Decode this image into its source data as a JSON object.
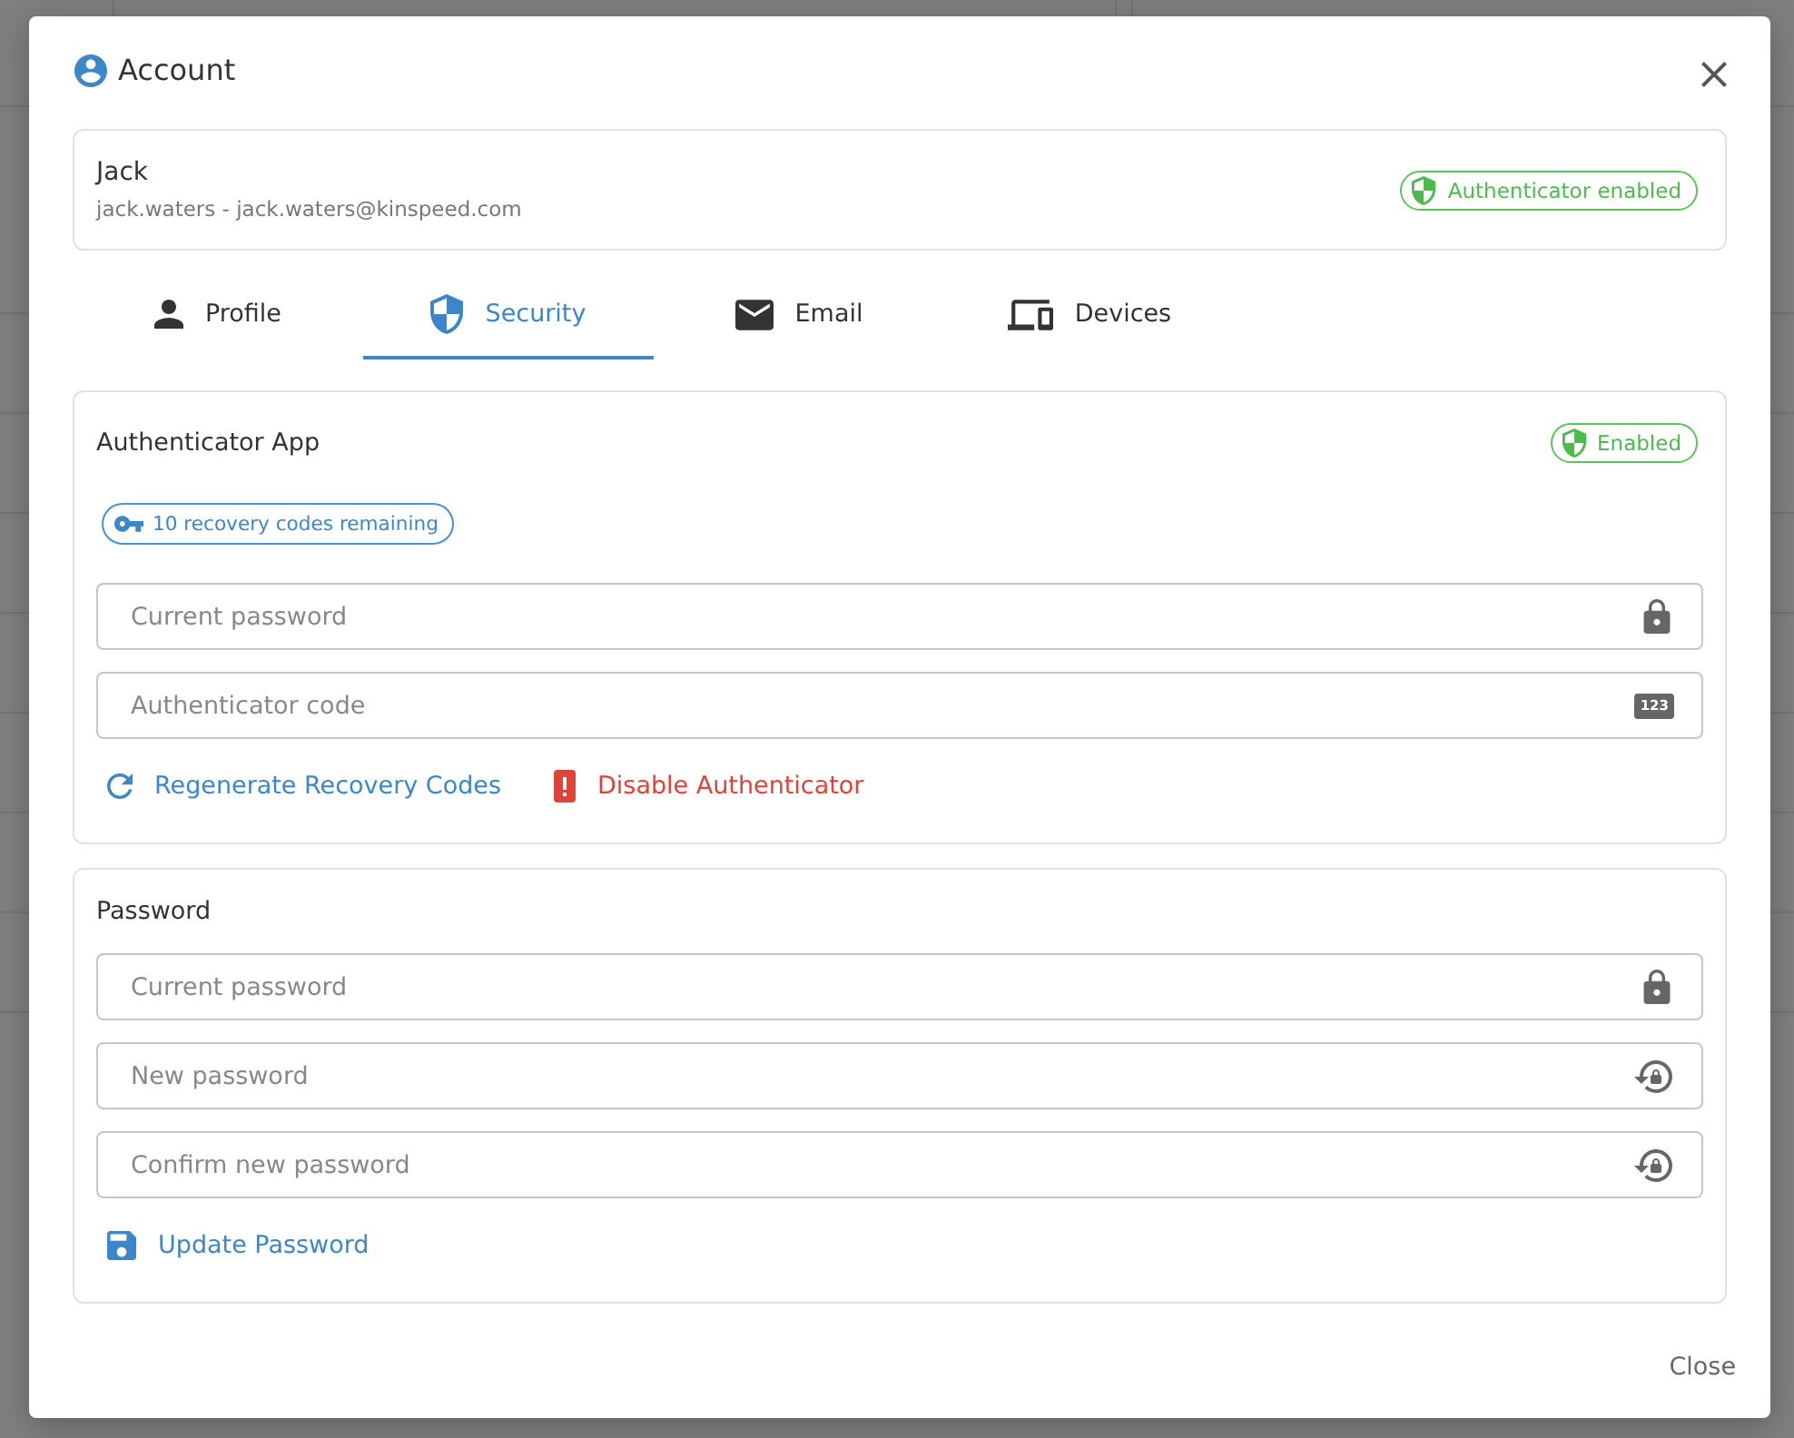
{
  "dialog": {
    "title": "Account",
    "user": {
      "name": "Jack",
      "detail": "jack.waters - jack.waters@kinspeed.com",
      "badge": "Authenticator enabled"
    },
    "tabs": [
      {
        "label": "Profile",
        "kind": "profile",
        "selected": false
      },
      {
        "label": "Security",
        "kind": "security",
        "selected": true
      },
      {
        "label": "Email",
        "kind": "email",
        "selected": false
      },
      {
        "label": "Devices",
        "kind": "devices",
        "selected": false
      }
    ],
    "sections": [
      {
        "title": "Authenticator App",
        "status": "Enabled",
        "recovery": "10 recovery codes remaining",
        "fields": [
          {
            "placeholder": "Current password",
            "kind": "lock"
          },
          {
            "placeholder": "Authenticator code",
            "kind": "code",
            "tag": "123"
          }
        ],
        "actions": [
          {
            "label": "Regenerate Recovery Codes",
            "kind": "regenerate"
          },
          {
            "label": "Disable Authenticator",
            "kind": "danger"
          }
        ]
      },
      {
        "title": "Password",
        "fields": [
          {
            "placeholder": "Current password",
            "kind": "lock"
          },
          {
            "placeholder": "New password",
            "kind": "reset"
          },
          {
            "placeholder": "Confirm new password",
            "kind": "reset"
          }
        ],
        "actions": [
          {
            "label": "Update Password",
            "kind": "save"
          }
        ]
      }
    ],
    "footer": {
      "close": "Close"
    }
  }
}
